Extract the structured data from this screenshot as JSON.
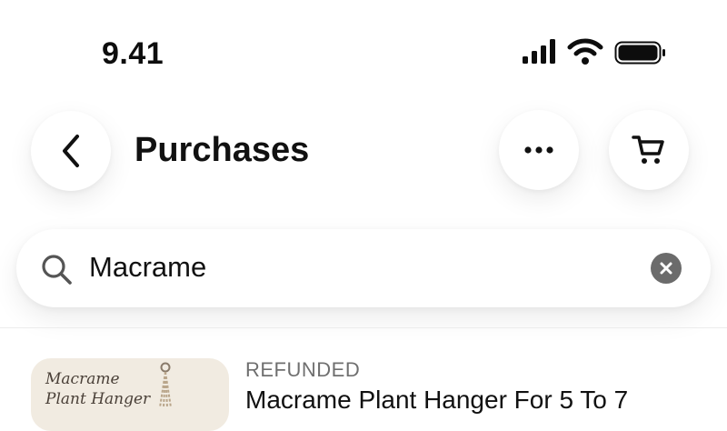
{
  "status_bar": {
    "time": "9.41",
    "icons": [
      "cellular-signal-icon",
      "wifi-icon",
      "battery-icon"
    ]
  },
  "header": {
    "title": "Purchases",
    "back_icon": "chevron-left-icon",
    "more_icon": "more-horizontal-icon",
    "cart_icon": "shopping-cart-icon"
  },
  "search": {
    "value": "Macrame",
    "icon": "search-icon",
    "clear_icon": "clear-icon"
  },
  "purchases": [
    {
      "status": "REFUNDED",
      "title": "Macrame Plant Hanger For 5 To 7",
      "thumbnail_text": "Macrame Plant Hanger"
    }
  ],
  "colors": {
    "background": "#ffffff",
    "text": "#111111",
    "muted": "#6f6f6f",
    "clear_button": "#6b6b6b"
  }
}
